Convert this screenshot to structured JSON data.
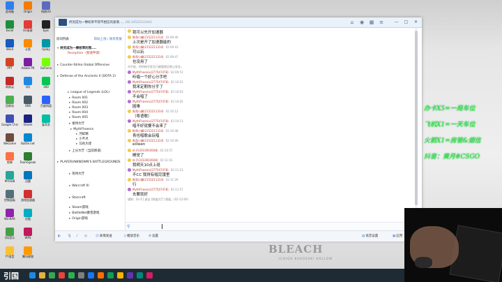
{
  "window": {
    "title": "终究成为一棵校草不得不相信的爱情.....",
    "id": "(ID:1452213144)",
    "buttons": {
      "minimize": "—",
      "maximize": "□",
      "close": "✕"
    }
  },
  "sidebar": {
    "header_left": "房间列表",
    "header_right": "帮助上线 / 联系客服",
    "room_name": "终究成为一棵校草的我....",
    "reception": "Reception（频道申请）",
    "channels": [
      "Counter-Strike Global Offensive",
      "Defense of the Ancients II (DOTA 2)",
      "League of Legends (LOL)",
      "Room 001",
      "Room 002",
      "Room 003",
      "Room 004",
      "Room 005",
      "接待大厅",
      "MythFhoenix",
      "河蚌精",
      "小不点",
      "马的大佬",
      "上分大厅（当前频道）",
      "PLAYERUNKNOWN'S BATTLEGROUNDS",
      "等待大厅",
      "Warcraft III",
      "Starcraft",
      "Steam游戏",
      "BattleNet暴雪游戏",
      "Origin游戏"
    ]
  },
  "messages": [
    {
      "nick": "",
      "time": "",
      "text": "我可以先开加速器"
    },
    {
      "nick": "陈哥小舅(2152211314)",
      "time": "02:09:40",
      "text": "上次是开了加速器能的"
    },
    {
      "nick": "陈哥小舅(2152211314)",
      "time": "02:09:43",
      "text": "可以玩"
    },
    {
      "nick": "陈哥小舅(2152211314)",
      "time": "02:09:47",
      "text": "也没用了"
    },
    {
      "nick": "系统",
      "time": "",
      "text": "对不起，你的帐号发言已被管理员禁止发言。"
    },
    {
      "nick": "MythFhoenix(277547478)",
      "time": "02:09:51",
      "text": "听唱一个好心分手吧"
    },
    {
      "nick": "MythFhoenix(277547478)",
      "time": "02:10:01",
      "text": "我来定期你分手了"
    },
    {
      "nick": "MythFhoenix(277547478)",
      "time": "02:10:03",
      "text": "不会唱了"
    },
    {
      "nick": "MythFhoenix(277547478)",
      "time": "02:10:05",
      "text": "困难"
    },
    {
      "nick": "陈哥小舅(2152211314)",
      "time": "02:10:12",
      "text": "（粤语歌）"
    },
    {
      "nick": "MythFhoenix(277547478)",
      "time": "02:10:13",
      "text": "唱不好就要不会来了"
    },
    {
      "nick": "陈哥小舅(2152211314)",
      "time": "02:10:48",
      "text": "青也唱歌会玩唱"
    },
    {
      "nick": "陈哥小舅(2152211314)",
      "time": "02:10:49",
      "text": "eilleen"
    },
    {
      "nick": "叶子(2033910048)",
      "time": "02:10:57",
      "text": "睡觉了"
    },
    {
      "nick": "叶子(2033910048)",
      "time": "02:11:03",
      "text": "我明天10点上班"
    },
    {
      "nick": "MythFhoenix(277547478)",
      "time": "02:11:23",
      "text": "不CC 我得有唱完饿里"
    },
    {
      "nick": "陈哥小舅(2152211314)",
      "time": "02:11:29",
      "text": "行"
    },
    {
      "nick": "MythFhoenix(277547478)",
      "time": "02:11:57",
      "text": "去要就好"
    },
    {
      "nick": "系统",
      "time": "",
      "text": "通知：[叶子] 退出 [频道大厅] 频道。(02:12:00)"
    }
  ],
  "toolbar": {
    "left": [
      "表情发送",
      "播放音乐",
      "设置"
    ],
    "right": [
      "语音设置",
      "应用"
    ]
  },
  "overlay": [
    "办卡X5=一局车位",
    "飞机X1=一天车位",
    "火箭X1=房管&烟信",
    "抖音：黄月#CSGO"
  ],
  "wallpaper": {
    "logo": "BLEACH",
    "subtitle": "ICHIGO KUROSAKI HOLLOW"
  },
  "taskbar": {
    "start_logo": "引国"
  },
  "desktop": {
    "icons": [
      "此电脑",
      "Excel",
      "Word",
      "PPT",
      "网易云",
      "回收站",
      "Google Chrome",
      "WeGame",
      "剪映",
      "MYODB",
      "控制面板",
      "WinRAR",
      "QQ音乐",
      "YY语音",
      "Origin",
      "EV录屏",
      "斗鱼",
      "Adobe PR",
      "QQ",
      "OBS",
      "Steam",
      "Battle.net",
      "TeamSpeak",
      "迅雷",
      "游戏加速器",
      "优酷",
      "WPS",
      "腾讯视频",
      "网易UU",
      "Epic",
      "Uplay",
      "GeForce",
      "360",
      "百度网盘",
      "爱奇艺"
    ]
  }
}
